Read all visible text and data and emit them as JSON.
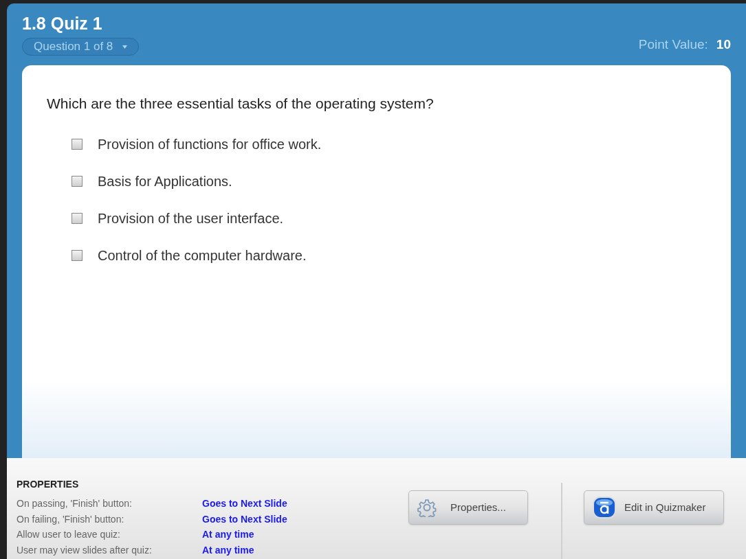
{
  "quiz": {
    "title": "1.8 Quiz 1",
    "question_selector": "Question 1 of 8",
    "point_value_label": "Point Value:",
    "point_value": "10"
  },
  "question": "Which are the three essential tasks of the operating system?",
  "options": [
    {
      "label": "Provision of functions for office work.",
      "checked": false
    },
    {
      "label": "Basis for Applications.",
      "checked": false
    },
    {
      "label": "Provision of the user interface.",
      "checked": false
    },
    {
      "label": "Control of the computer hardware.",
      "checked": false
    }
  ],
  "properties": {
    "heading": "PROPERTIES",
    "rows": [
      {
        "name": "On passing, 'Finish' button:",
        "value": "Goes to Next Slide"
      },
      {
        "name": "On failing, 'Finish' button:",
        "value": "Goes to Next Slide"
      },
      {
        "name": "Allow user to leave quiz:",
        "value": "At any time"
      },
      {
        "name": "User may view slides after quiz:",
        "value": "At any time"
      }
    ]
  },
  "buttons": [
    {
      "kind": "properties",
      "label": "Properties..."
    },
    {
      "kind": "quizmaker",
      "label": "Edit in Quizmaker"
    }
  ]
}
